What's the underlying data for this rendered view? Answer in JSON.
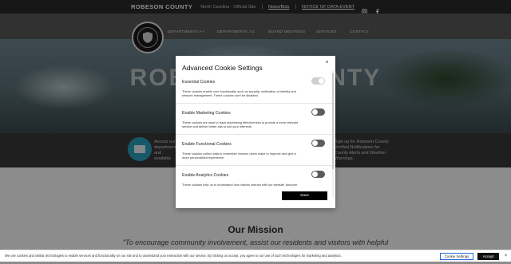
{
  "topbar": {
    "brand": "ROBESON COUNTY",
    "subtitle": "North Carolina - Official Site",
    "sep1": "|",
    "link_jobs": "News/Bids",
    "sep2": "|",
    "link_notice": "NOTICE OF DATA EVENT",
    "icons": [
      "instagram-icon",
      "facebook-icon"
    ]
  },
  "nav": {
    "items": [
      "DEPARTMENTS A-I",
      "DEPARTMENTS J-Z",
      "BOARD MEETINGS",
      "SERVICES",
      "CONTACT"
    ]
  },
  "hero": {
    "title": "ROBESON COUNTY"
  },
  "band": {
    "left_text": "Access our department and available",
    "right_text": "Sign up for Robeson County Verified Notifications for County Alerts and Weather Warnings."
  },
  "mission": {
    "title": "Our Mission",
    "text": "\"To encourage community involvement, assist our residents and visitors with helpful"
  },
  "modal": {
    "title": "Advanced Cookie Settings",
    "close_label": "×",
    "save_label": "Save",
    "settings": [
      {
        "title": "Essential Cookies",
        "desc": "These cookies enable core functionality such as security, verification of identity and network management. These cookies can't be disabled.",
        "state": "on"
      },
      {
        "title": "Enable Marketing Cookies",
        "desc": "These cookies are used to track advertising effectiveness to provide a more relevant service and deliver better ads to suit your interests.",
        "state": "off"
      },
      {
        "title": "Enable Functional Cookies",
        "desc": "These cookies collect data to remember choices users make to improve and give a more personalized experience.",
        "state": "off"
      },
      {
        "title": "Enable Analytics Cookies",
        "desc": "These cookies help us to understand how visitors interact with our website, discover",
        "state": "off"
      }
    ]
  },
  "cookiebar": {
    "text": "We use cookies and similar technologies to enable services and functionality on our site and to understand your interaction with our service. By clicking on accept, you agree to our use of such technologies for marketing and analytics.",
    "settings_label": "Cookie Settings",
    "accept_label": "Accept",
    "close_label": "×"
  },
  "colors": {
    "topbar": "#2b2b2b",
    "nav": "#595959",
    "band": "#3a3a3a",
    "band_icon": "#2aa3bf",
    "save_button": "#000000"
  }
}
